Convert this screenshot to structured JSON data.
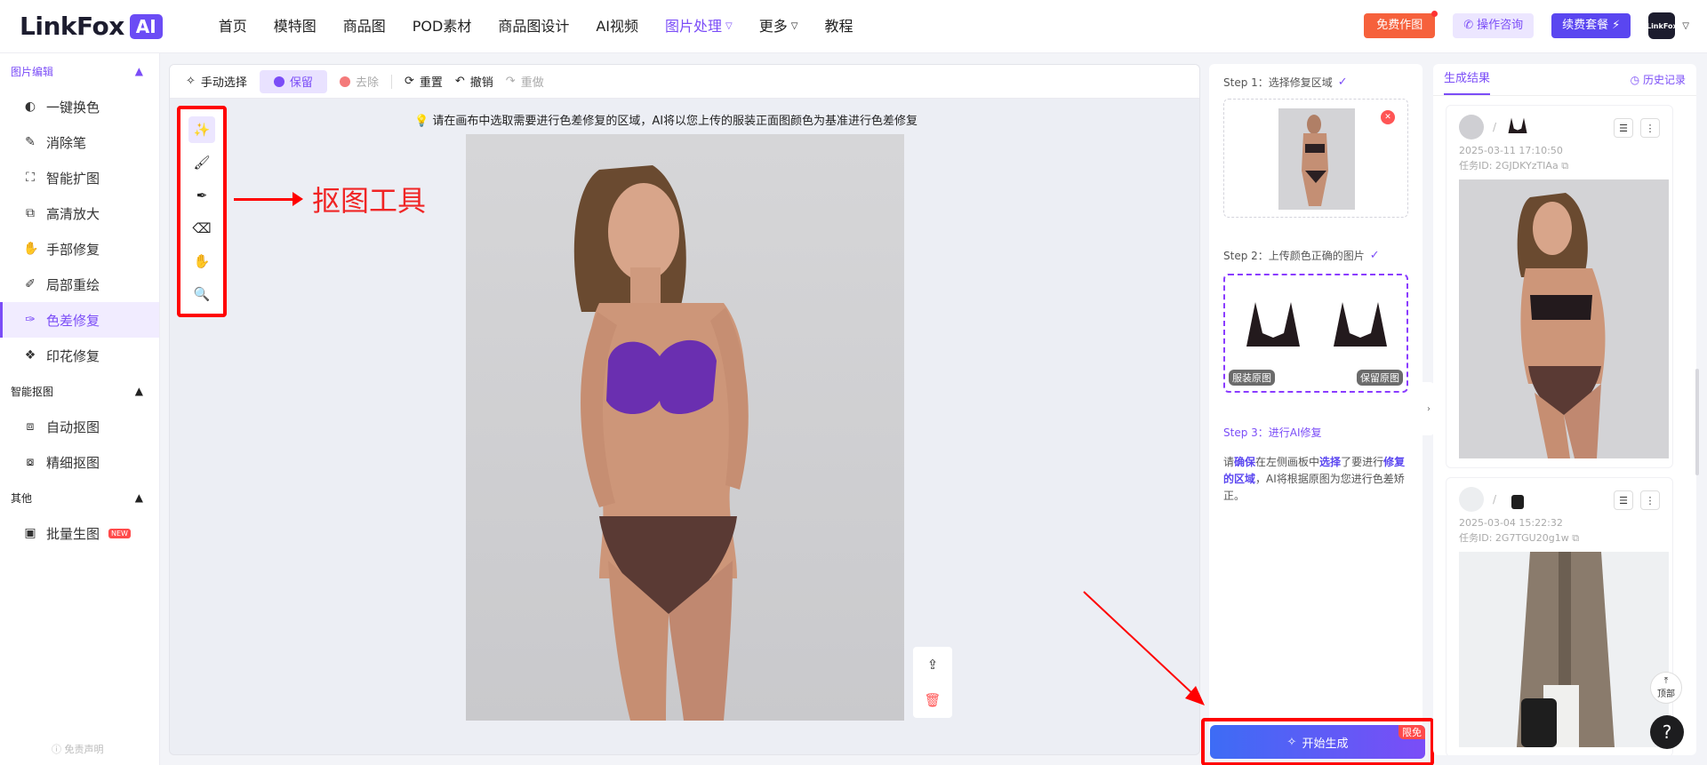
{
  "brand": {
    "name": "LinkFox",
    "badge": "AI"
  },
  "nav": [
    {
      "label": "首页"
    },
    {
      "label": "模特图"
    },
    {
      "label": "商品图"
    },
    {
      "label": "POD素材"
    },
    {
      "label": "商品图设计"
    },
    {
      "label": "AI视频"
    },
    {
      "label": "图片处理",
      "active": true
    },
    {
      "label": "更多"
    },
    {
      "label": "教程"
    }
  ],
  "header": {
    "free_btn": "免费作图",
    "consult_btn": "操作咨询",
    "renew_btn": "续费套餐",
    "avatar_text": "LinkFox"
  },
  "sidebar": {
    "groups": [
      {
        "title": "图片编辑",
        "items": [
          "一键换色",
          "消除笔",
          "智能扩图",
          "高清放大",
          "手部修复",
          "局部重绘",
          "色差修复",
          "印花修复"
        ]
      },
      {
        "title": "智能抠图",
        "items": [
          "自动抠图",
          "精细抠图"
        ]
      },
      {
        "title": "其他",
        "items": [
          "批量生图"
        ]
      }
    ],
    "active_item": "色差修复",
    "new_badge": "NEW",
    "disclaimer": "免责声明"
  },
  "toolbar": {
    "manual": "手动选择",
    "keep": "保留",
    "remove": "去除",
    "reset": "重置",
    "undo": "撤销",
    "redo": "重做"
  },
  "canvas": {
    "hint": "请在画布中选取需要进行色差修复的区域，AI将以您上传的服装正面图颜色为基准进行色差修复",
    "annotation": "抠图工具"
  },
  "steps": {
    "step1": "Step 1：选择修复区域",
    "step2": "Step 2：上传颜色正确的图片",
    "tag_left": "服装原图",
    "tag_right": "保留原图",
    "step3": "Step 3：进行AI修复",
    "desc_parts": [
      "请",
      "确保",
      "在左侧画板中",
      "选择",
      "了要进行",
      "修复的区域",
      "，AI将根据原图为您进行色差矫正。"
    ],
    "generate": "开始生成",
    "limit": "限免"
  },
  "results": {
    "tab": "生成结果",
    "history": "历史记录",
    "cards": [
      {
        "date": "2025-03-11 17:10:50",
        "task_id": "任务ID: 2GJDKYzTIAa"
      },
      {
        "date": "2025-03-04 15:22:32",
        "task_id": "任务ID: 2G7TGU20g1w"
      }
    ]
  },
  "float": {
    "top": "顶部",
    "help": "?"
  },
  "colors": {
    "accent": "#7b4df7",
    "annotation": "#f00000",
    "garment_top": "#6a2fb0",
    "garment_bottom": "#5a3a34"
  }
}
